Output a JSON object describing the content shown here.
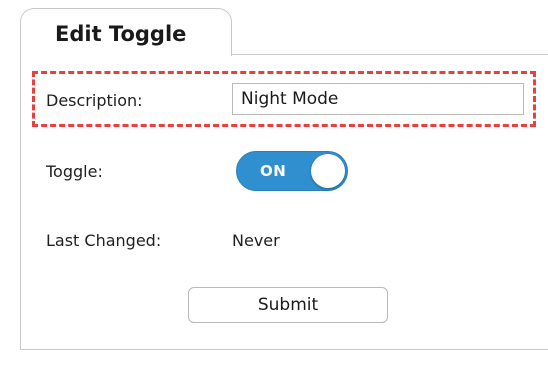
{
  "tab": {
    "label": "Edit Toggle"
  },
  "form": {
    "description_label": "Description:",
    "description_value": "Night Mode",
    "toggle_label": "Toggle:",
    "toggle_state": "ON",
    "toggle_on": true,
    "last_changed_label": "Last Changed:",
    "last_changed_value": "Never",
    "submit_label": "Submit"
  },
  "colors": {
    "toggle_on": "#2f8fcf",
    "highlight_border": "#e8403a",
    "panel_border": "#c9c9c9"
  }
}
